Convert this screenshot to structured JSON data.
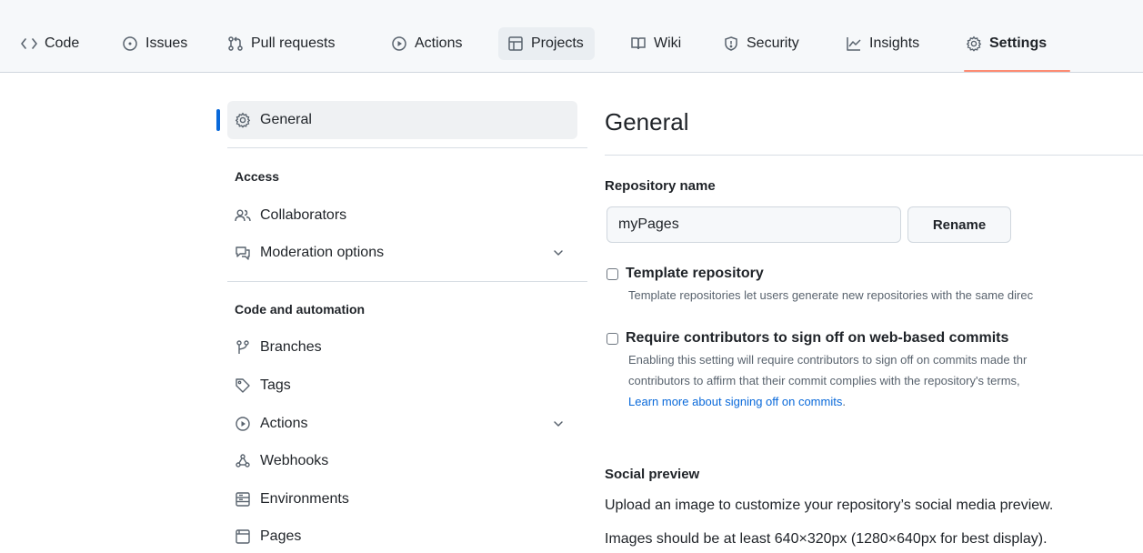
{
  "repo_nav": {
    "tabs": [
      {
        "label": "Code",
        "icon": "code-icon"
      },
      {
        "label": "Issues",
        "icon": "issue-opened-icon"
      },
      {
        "label": "Pull requests",
        "icon": "git-pull-request-icon"
      },
      {
        "label": "Actions",
        "icon": "play-icon"
      },
      {
        "label": "Projects",
        "icon": "table-icon"
      },
      {
        "label": "Wiki",
        "icon": "book-icon"
      },
      {
        "label": "Security",
        "icon": "shield-icon"
      },
      {
        "label": "Insights",
        "icon": "graph-icon"
      },
      {
        "label": "Settings",
        "icon": "gear-icon",
        "selected": true
      }
    ]
  },
  "sidebar": {
    "general": {
      "label": "General",
      "icon": "gear-icon",
      "active": true
    },
    "sections": [
      {
        "heading": "Access",
        "items": [
          {
            "label": "Collaborators",
            "icon": "people-icon"
          },
          {
            "label": "Moderation options",
            "icon": "report-icon",
            "expandable": true
          }
        ]
      },
      {
        "heading": "Code and automation",
        "items": [
          {
            "label": "Branches",
            "icon": "git-branch-icon"
          },
          {
            "label": "Tags",
            "icon": "tag-icon"
          },
          {
            "label": "Actions",
            "icon": "play-icon",
            "expandable": true
          },
          {
            "label": "Webhooks",
            "icon": "webhook-icon"
          },
          {
            "label": "Environments",
            "icon": "server-icon"
          },
          {
            "label": "Pages",
            "icon": "browser-icon"
          }
        ]
      }
    ]
  },
  "main": {
    "title": "General",
    "repository_name": {
      "label": "Repository name",
      "value": "myPages",
      "rename_button": "Rename"
    },
    "template_repository": {
      "label": "Template repository",
      "checked": false,
      "description": "Template repositories let users generate new repositories with the same direc"
    },
    "signoff": {
      "label": "Require contributors to sign off on web-based commits",
      "checked": false,
      "description_line1": "Enabling this setting will require contributors to sign off on commits made thr",
      "description_line2": "contributors to affirm that their commit complies with the repository's terms,",
      "learn_more": "Learn more about signing off on commits",
      "learn_more_suffix": "."
    },
    "social_preview": {
      "heading": "Social preview",
      "line1": "Upload an image to customize your repository’s social media preview.",
      "line2": "Images should be at least 640×320px (1280×640px for best display)."
    }
  },
  "colors": {
    "accent_blue": "#0969da",
    "selected_tab_underline": "#fd8c73",
    "nav_background": "#f6f8fa",
    "muted_text": "#59636e"
  }
}
